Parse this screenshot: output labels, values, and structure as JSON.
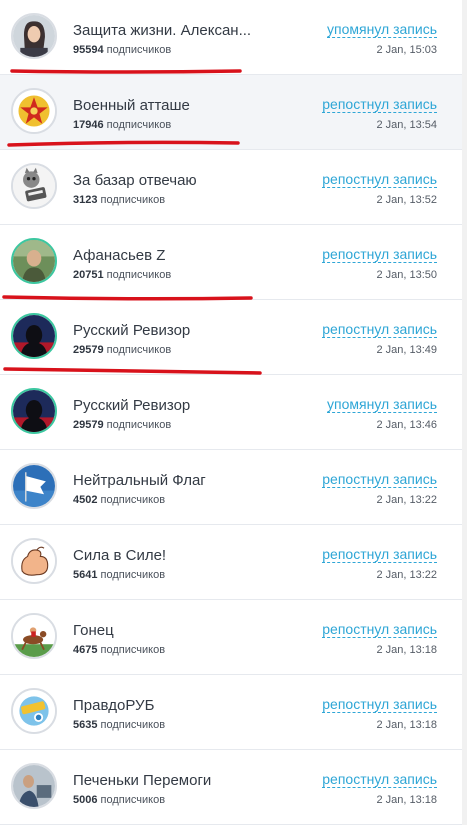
{
  "subscribers_suffix": "подписчиков",
  "items": [
    {
      "name": "Защита жизни. Алексан...",
      "subscribers": "95594",
      "action": "упомянул запись",
      "time": "2 Jan, 15:03"
    },
    {
      "name": "Военный атташе",
      "subscribers": "17946",
      "action": "репостнул запись",
      "time": "2 Jan, 13:54"
    },
    {
      "name": "За базар отвечаю",
      "subscribers": "3123",
      "action": "репостнул запись",
      "time": "2 Jan, 13:52"
    },
    {
      "name": "Афанасьев Z",
      "subscribers": "20751",
      "action": "репостнул запись",
      "time": "2 Jan, 13:50"
    },
    {
      "name": "Русский Ревизор",
      "subscribers": "29579",
      "action": "репостнул запись",
      "time": "2 Jan, 13:49"
    },
    {
      "name": "Русский Ревизор",
      "subscribers": "29579",
      "action": "упомянул запись",
      "time": "2 Jan, 13:46"
    },
    {
      "name": "Нейтральный Флаг",
      "subscribers": "4502",
      "action": "репостнул запись",
      "time": "2 Jan, 13:22"
    },
    {
      "name": "Сила в Силе!",
      "subscribers": "5641",
      "action": "репостнул запись",
      "time": "2 Jan, 13:22"
    },
    {
      "name": "Гонец",
      "subscribers": "4675",
      "action": "репостнул запись",
      "time": "2 Jan, 13:18"
    },
    {
      "name": "ПравдоРУБ",
      "subscribers": "5635",
      "action": "репостнул запись",
      "time": "2 Jan, 13:18"
    },
    {
      "name": "Печеньки Перемоги",
      "subscribers": "5006",
      "action": "репостнул запись",
      "time": "2 Jan, 13:18"
    }
  ],
  "colors": {
    "accent": "#2ea6d6",
    "annotation": "#d8121b",
    "active_ring": "#3cc7a0"
  }
}
